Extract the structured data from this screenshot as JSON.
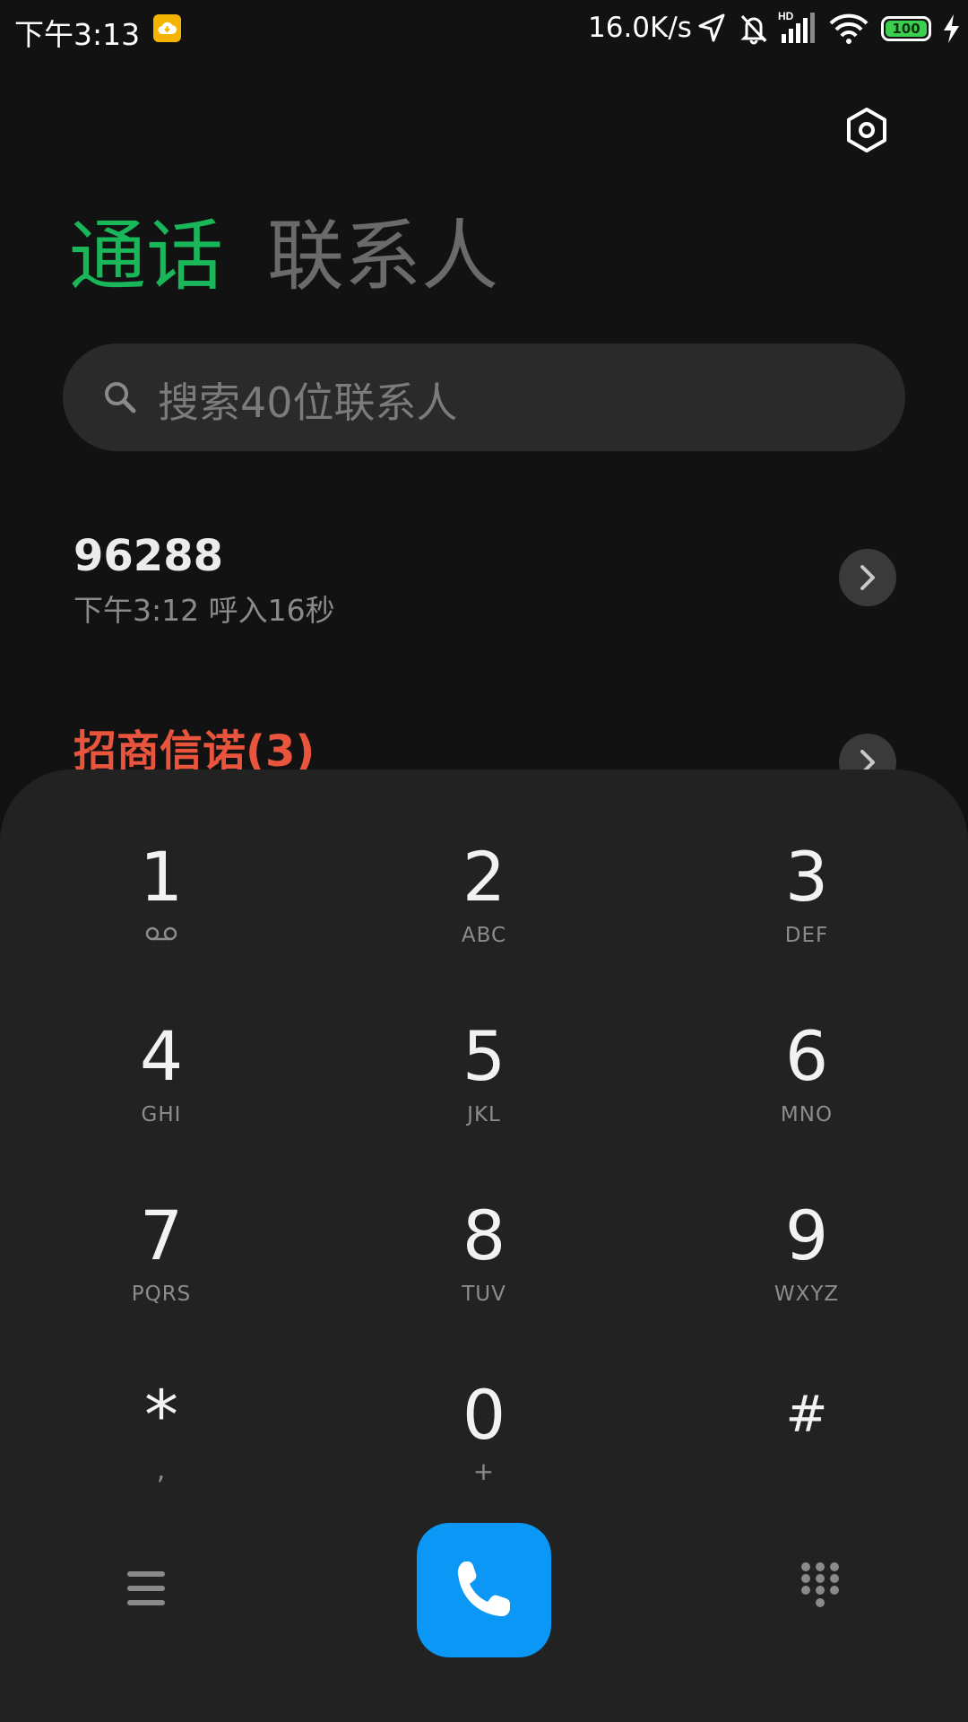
{
  "status_bar": {
    "time": "下午3:13",
    "network_speed": "16.0K/s",
    "battery_level": "100",
    "cloud_icon": "cloud-icon",
    "location_icon": "location-arrow-icon",
    "mute_icon": "bell-muted-icon",
    "signal_icon": "hd-signal-icon",
    "wifi_icon": "wifi-icon",
    "charging_icon": "bolt-icon"
  },
  "header": {
    "settings_icon": "gear-icon",
    "tabs": [
      {
        "label": "通话",
        "active": true
      },
      {
        "label": "联系人",
        "active": false
      }
    ]
  },
  "search": {
    "placeholder": "搜索40位联系人"
  },
  "call_log": [
    {
      "name": "96288",
      "detail": "下午3:12 呼入16秒",
      "missed": false
    },
    {
      "name": "招商信诺(3)",
      "detail": "",
      "missed": true
    }
  ],
  "dialpad": {
    "keys": [
      {
        "digit": "1",
        "letters": ""
      },
      {
        "digit": "2",
        "letters": "ABC"
      },
      {
        "digit": "3",
        "letters": "DEF"
      },
      {
        "digit": "4",
        "letters": "GHI"
      },
      {
        "digit": "5",
        "letters": "JKL"
      },
      {
        "digit": "6",
        "letters": "MNO"
      },
      {
        "digit": "7",
        "letters": "PQRS"
      },
      {
        "digit": "8",
        "letters": "TUV"
      },
      {
        "digit": "9",
        "letters": "WXYZ"
      },
      {
        "digit": "*",
        "letters": ","
      },
      {
        "digit": "0",
        "letters": "+"
      },
      {
        "digit": "#",
        "letters": ""
      }
    ],
    "voicemail_icon": "voicemail-icon"
  },
  "bottom_bar": {
    "menu_icon": "menu-icon",
    "call_icon": "phone-icon",
    "keypad_icon": "keypad-icon"
  },
  "colors": {
    "accent_green": "#19b75a",
    "missed_red": "#e9543d",
    "call_blue": "#0a97f5"
  }
}
